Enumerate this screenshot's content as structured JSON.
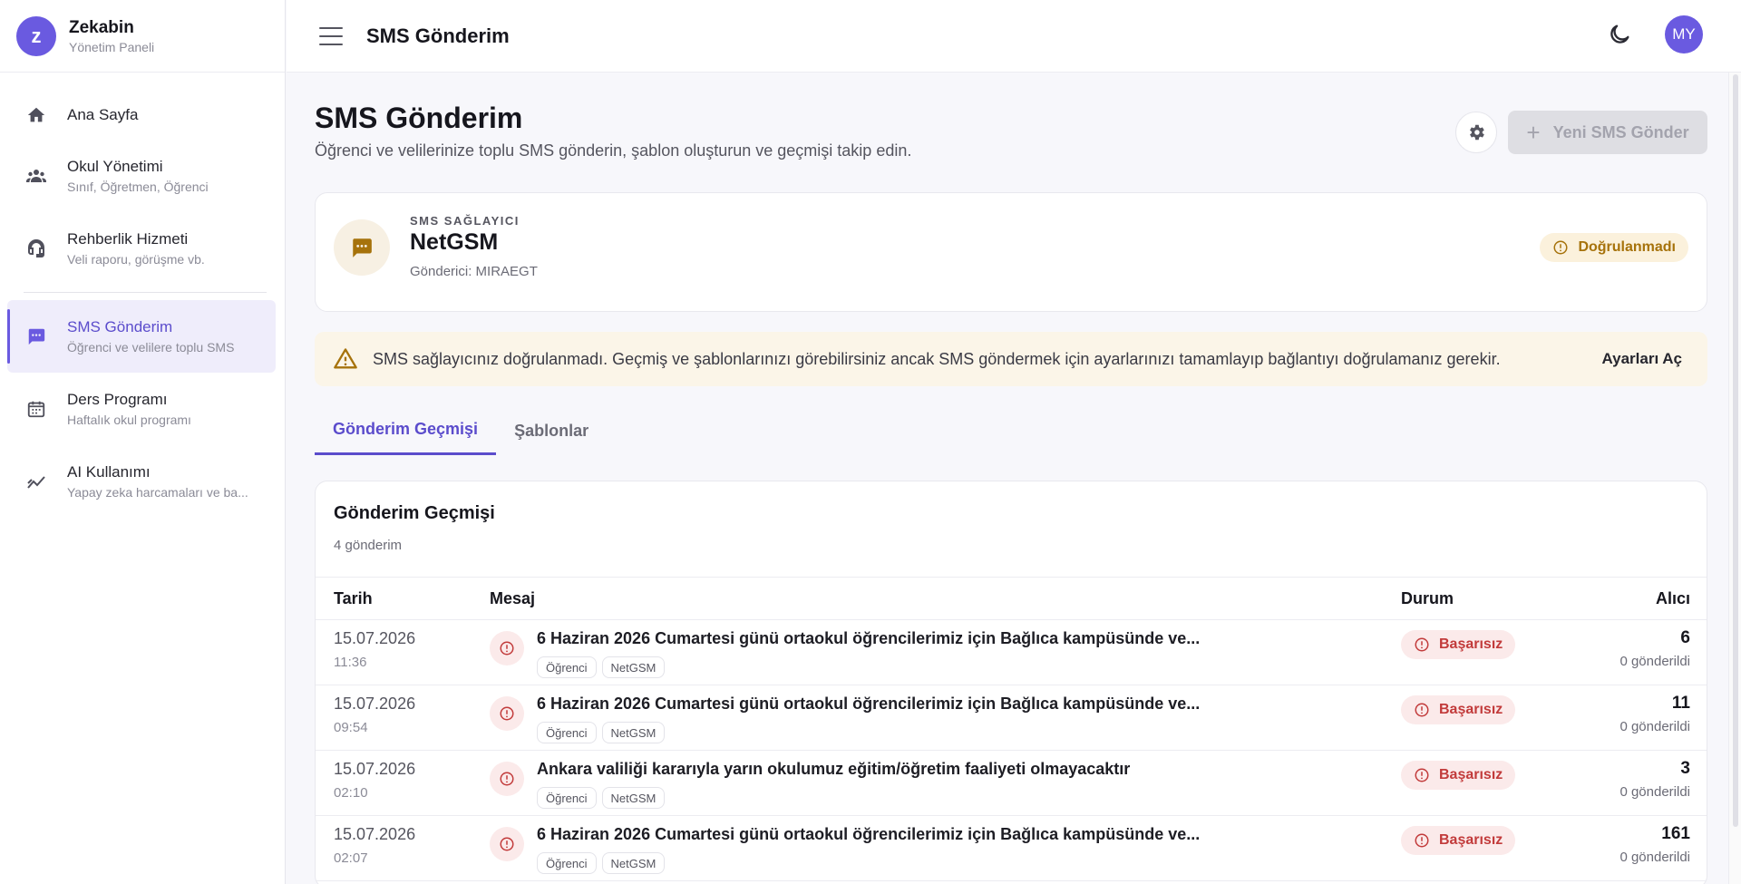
{
  "brand": {
    "logo_letter": "z",
    "title": "Zekabin",
    "subtitle": "Yönetim Paneli"
  },
  "sidebar": {
    "items": [
      {
        "label": "Ana Sayfa",
        "sub": "",
        "icon": "home-icon"
      },
      {
        "label": "Okul Yönetimi",
        "sub": "Sınıf, Öğretmen, Öğrenci",
        "icon": "people-icon"
      },
      {
        "label": "Rehberlik Hizmeti",
        "sub": "Veli raporu, görüşme vb.",
        "icon": "headset-icon"
      },
      {
        "label": "SMS Gönderim",
        "sub": "Öğrenci ve velilere toplu SMS",
        "icon": "sms-icon",
        "active": true
      },
      {
        "label": "Ders Programı",
        "sub": "Haftalık okul programı",
        "icon": "calendar-icon"
      },
      {
        "label": "AI Kullanımı",
        "sub": "Yapay zeka harcamaları ve ba...",
        "icon": "chart-icon"
      }
    ]
  },
  "topbar": {
    "title": "SMS Gönderim",
    "avatar_initials": "MY"
  },
  "page": {
    "title": "SMS Gönderim",
    "description": "Öğrenci ve velilerinize toplu SMS gönderin, şablon oluşturun ve geçmişi takip edin.",
    "new_button": "Yeni SMS Gönder"
  },
  "provider": {
    "label": "SMS SAĞLAYICI",
    "name": "NetGSM",
    "sender": "Gönderici: MIRAEGT",
    "status": "Doğrulanmadı"
  },
  "warning": {
    "text": "SMS sağlayıcınız doğrulanmadı. Geçmiş ve şablonlarınızı görebilirsiniz ancak SMS göndermek için ayarlarınızı tamamlayıp bağlantıyı doğrulamanız gerekir.",
    "action": "Ayarları Aç"
  },
  "tabs": [
    {
      "label": "Gönderim Geçmişi",
      "active": true
    },
    {
      "label": "Şablonlar",
      "active": false
    }
  ],
  "history": {
    "title": "Gönderim Geçmişi",
    "count": "4 gönderim",
    "columns": {
      "date": "Tarih",
      "message": "Mesaj",
      "status": "Durum",
      "recipients": "Alıcı"
    },
    "rows": [
      {
        "date": "15.07.2026",
        "time": "11:36",
        "message": "6 Haziran 2026 Cumartesi günü ortaokul öğrencilerimiz için Bağlıca kampüsünde ve...",
        "tags": [
          "Öğrenci",
          "NetGSM"
        ],
        "status": "Başarısız",
        "recipients": "6",
        "sent": "0 gönderildi"
      },
      {
        "date": "15.07.2026",
        "time": "09:54",
        "message": "6 Haziran 2026 Cumartesi günü ortaokul öğrencilerimiz için Bağlıca kampüsünde ve...",
        "tags": [
          "Öğrenci",
          "NetGSM"
        ],
        "status": "Başarısız",
        "recipients": "11",
        "sent": "0 gönderildi"
      },
      {
        "date": "15.07.2026",
        "time": "02:10",
        "message": "Ankara valiliği kararıyla yarın okulumuz eğitim/öğretim faaliyeti olmayacaktır",
        "tags": [
          "Öğrenci",
          "NetGSM"
        ],
        "status": "Başarısız",
        "recipients": "3",
        "sent": "0 gönderildi"
      },
      {
        "date": "15.07.2026",
        "time": "02:07",
        "message": "6 Haziran 2026 Cumartesi günü ortaokul öğrencilerimiz için Bağlıca kampüsünde ve...",
        "tags": [
          "Öğrenci",
          "NetGSM"
        ],
        "status": "Başarısız",
        "recipients": "161",
        "sent": "0 gönderildi"
      }
    ]
  },
  "colors": {
    "accent": "#6a5ae0",
    "warning": "#a6720b",
    "error": "#c23b3b"
  }
}
